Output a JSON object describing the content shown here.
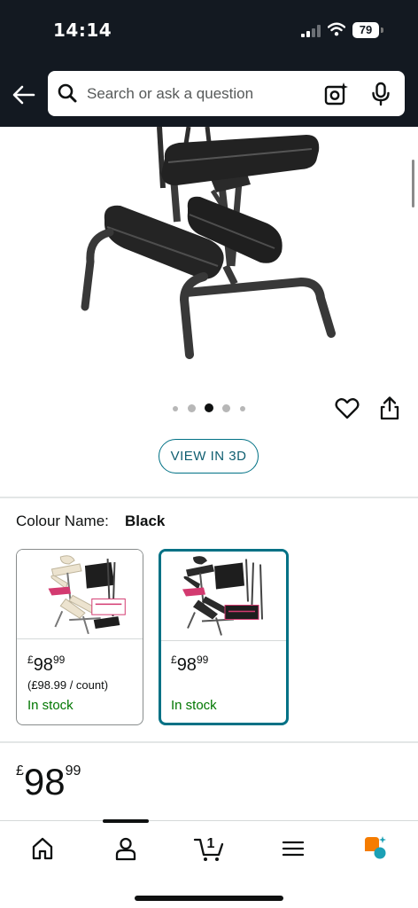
{
  "status_bar": {
    "time": "14:14",
    "battery": "79",
    "icons": [
      "cellular-signal-icon",
      "wifi-icon",
      "battery-icon"
    ]
  },
  "search": {
    "placeholder": "Search or ask a question",
    "icons": [
      "back-arrow-icon",
      "search-icon",
      "camera-search-icon",
      "microphone-icon"
    ]
  },
  "gallery": {
    "image": "black-portable-massage-chair",
    "dot_count": 5,
    "active_dot": 2,
    "icons": [
      "heart-icon",
      "share-icon"
    ],
    "view_3d_label": "VIEW IN 3D"
  },
  "variation": {
    "label": "Colour Name:",
    "selected": "Black",
    "options": [
      {
        "name": "beige-massage-chair",
        "currency": "£",
        "whole": "98",
        "fraction": "99",
        "unit_price": "(£98.99 / count)",
        "availability": "In stock",
        "selected": false
      },
      {
        "name": "black-massage-chair",
        "currency": "£",
        "whole": "98",
        "fraction": "99",
        "availability": "In stock",
        "selected": true
      }
    ]
  },
  "price": {
    "currency": "£",
    "whole": "98",
    "fraction": "99"
  },
  "bottom_nav": {
    "items": [
      "home-icon",
      "account-icon",
      "cart-icon",
      "menu-icon",
      "rufus-assistant-icon"
    ],
    "cart_count": "1",
    "active": "account"
  },
  "colors": {
    "header_bg": "#131921",
    "accent_teal": "#007185",
    "in_stock_green": "#007600",
    "rufus_orange": "#f57c00",
    "rufus_teal": "#1ba0b5"
  }
}
